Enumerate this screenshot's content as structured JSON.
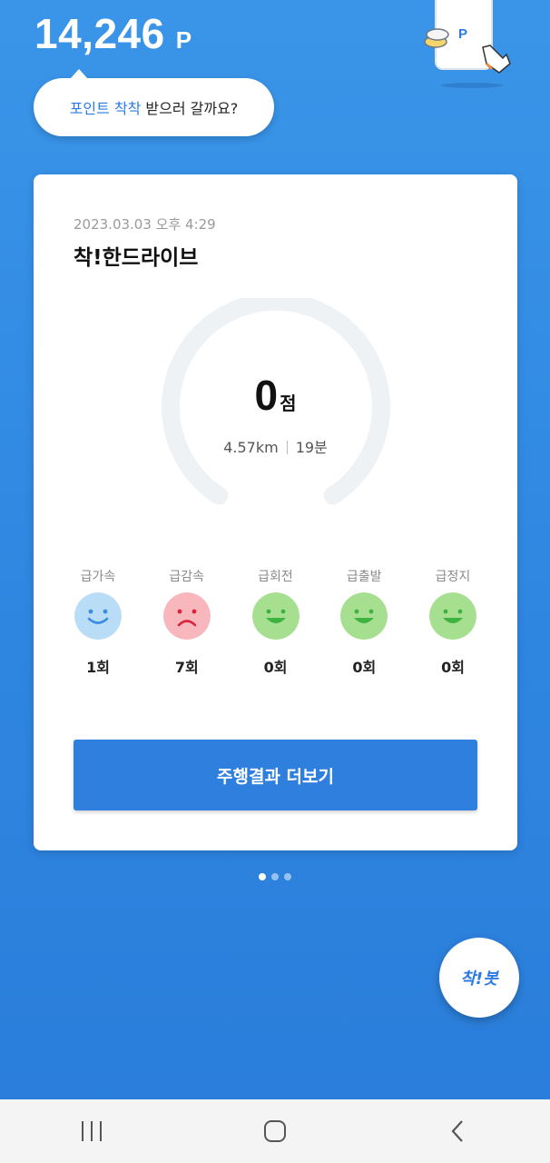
{
  "header": {
    "points_value": "14,246",
    "points_unit": "P",
    "bubble_highlight": "포인트 착착",
    "bubble_text": "받으러 갈까요?",
    "illustration_badge": "P"
  },
  "card": {
    "datetime": "2023.03.03 오후 4:29",
    "title": "착!한드라이브",
    "score": {
      "value": "0",
      "unit": "점",
      "level": 0
    },
    "distance": "4.57km",
    "duration": "19분",
    "events": [
      {
        "label": "급가속",
        "count": "1회",
        "face": "smile",
        "color": "#b9dcf7",
        "accent": "#3a8ee0"
      },
      {
        "label": "급감속",
        "count": "7회",
        "face": "sad",
        "color": "#f7b7bd",
        "accent": "#d9253a"
      },
      {
        "label": "급회전",
        "count": "0회",
        "face": "grin",
        "color": "#a6df8f",
        "accent": "#3fb33f"
      },
      {
        "label": "급출발",
        "count": "0회",
        "face": "grin",
        "color": "#a6df8f",
        "accent": "#3fb33f"
      },
      {
        "label": "급정지",
        "count": "0회",
        "face": "grin",
        "color": "#a6df8f",
        "accent": "#3fb33f"
      }
    ],
    "more_button": "주행결과 더보기"
  },
  "pager": {
    "count": 3,
    "active_index": 0
  },
  "fab_label": "착!봇",
  "colors": {
    "background": "#3390e5",
    "accent": "#2f80de",
    "gauge_track": "#eef2f5"
  },
  "navbar": {
    "buttons": [
      "recent-apps-icon",
      "home-icon",
      "back-icon"
    ]
  }
}
